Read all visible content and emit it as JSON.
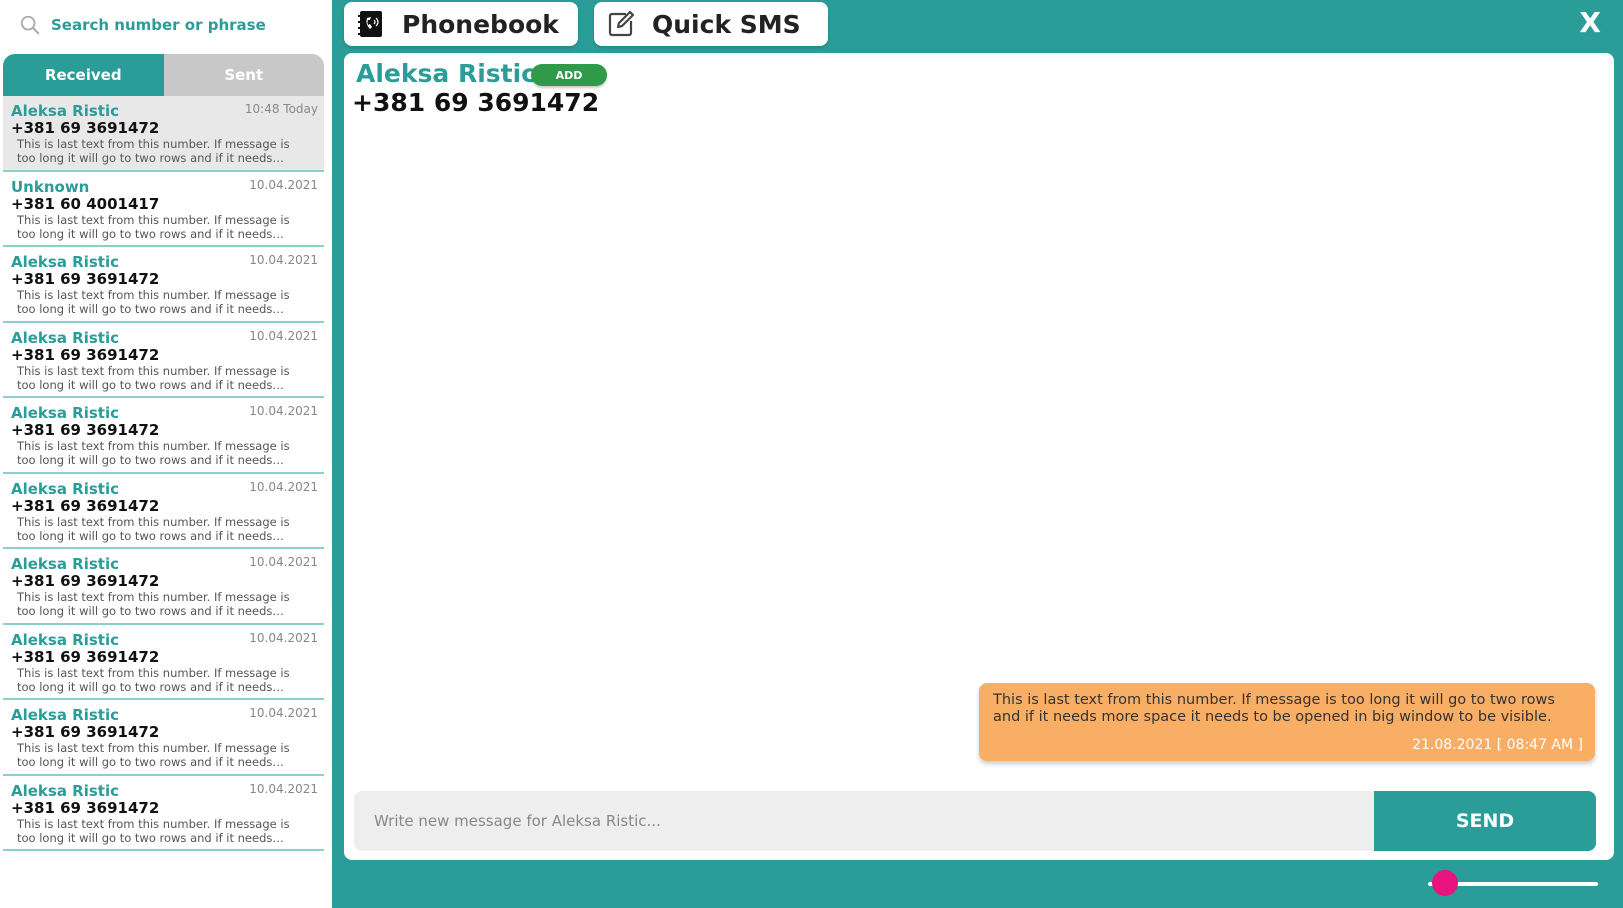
{
  "search": {
    "placeholder": "Search number or phrase"
  },
  "tabs": {
    "received": "Received",
    "sent": "Sent"
  },
  "messages": [
    {
      "name": "Aleksa Ristic",
      "number": "+381 69 3691472",
      "date": "10:48 Today",
      "text": "This is last text from this number. If message is too long it will go to two rows and if it needs more space it needs to be opened in big window to be visible."
    },
    {
      "name": "Unknown",
      "number": "+381 60 4001417",
      "date": "10.04.2021",
      "text": "This is last text from this number. If message is too long it will go to two rows and if it needs more space it needs to be opened in big window to be visible."
    },
    {
      "name": "Aleksa Ristic",
      "number": "+381 69 3691472",
      "date": "10.04.2021",
      "text": "This is last text from this number. If message is too long it will go to two rows and if it needs more space it needs to be opened in big window to be visible."
    },
    {
      "name": "Aleksa Ristic",
      "number": "+381 69 3691472",
      "date": "10.04.2021",
      "text": "This is last text from this number. If message is too long it will go to two rows and if it needs more space it needs to be opened in big window to be visible."
    },
    {
      "name": "Aleksa Ristic",
      "number": "+381 69 3691472",
      "date": "10.04.2021",
      "text": "This is last text from this number. If message is too long it will go to two rows and if it needs more space it needs to be opened in big window to be visible."
    },
    {
      "name": "Aleksa Ristic",
      "number": "+381 69 3691472",
      "date": "10.04.2021",
      "text": "This is last text from this number. If message is too long it will go to two rows and if it needs more space it needs to be opened in big window to be visible."
    },
    {
      "name": "Aleksa Ristic",
      "number": "+381 69 3691472",
      "date": "10.04.2021",
      "text": "This is last text from this number. If message is too long it will go to two rows and if it needs more space it needs to be opened in big window to be visible."
    },
    {
      "name": "Aleksa Ristic",
      "number": "+381 69 3691472",
      "date": "10.04.2021",
      "text": "This is last text from this number. If message is too long it will go to two rows and if it needs more space it needs to be opened in big window to be visible."
    },
    {
      "name": "Aleksa Ristic",
      "number": "+381 69 3691472",
      "date": "10.04.2021",
      "text": "This is last text from this number. If message is too long it will go to two rows and if it needs more space it needs to be opened in big window to be visible."
    },
    {
      "name": "Aleksa Ristic",
      "number": "+381 69 3691472",
      "date": "10.04.2021",
      "text": "This is last text from this number. If message is too long it will go to two rows and if it needs more space it needs to be opened in big window to be visible."
    }
  ],
  "top": {
    "phonebook": "Phonebook",
    "quick_sms": "Quick SMS",
    "close": "X"
  },
  "conversation": {
    "name": "Aleksa Ristic",
    "add_label": "ADD",
    "number": "+381 69 3691472",
    "bubble_text": "This is last text from this number. If message is too long it will go to two rows and if it needs more space it needs to be opened in big window to be visible.",
    "bubble_time": "21.08.2021 [ 08:47 AM ]"
  },
  "compose": {
    "placeholder": "Write new message for Aleksa Ristic...",
    "send_label": "SEND"
  },
  "slider": {
    "value": 0.1
  },
  "colors": {
    "accent": "#2a9d99",
    "bubble": "#f9ae66",
    "add": "#2e9a4a",
    "knob": "#e8137c"
  }
}
